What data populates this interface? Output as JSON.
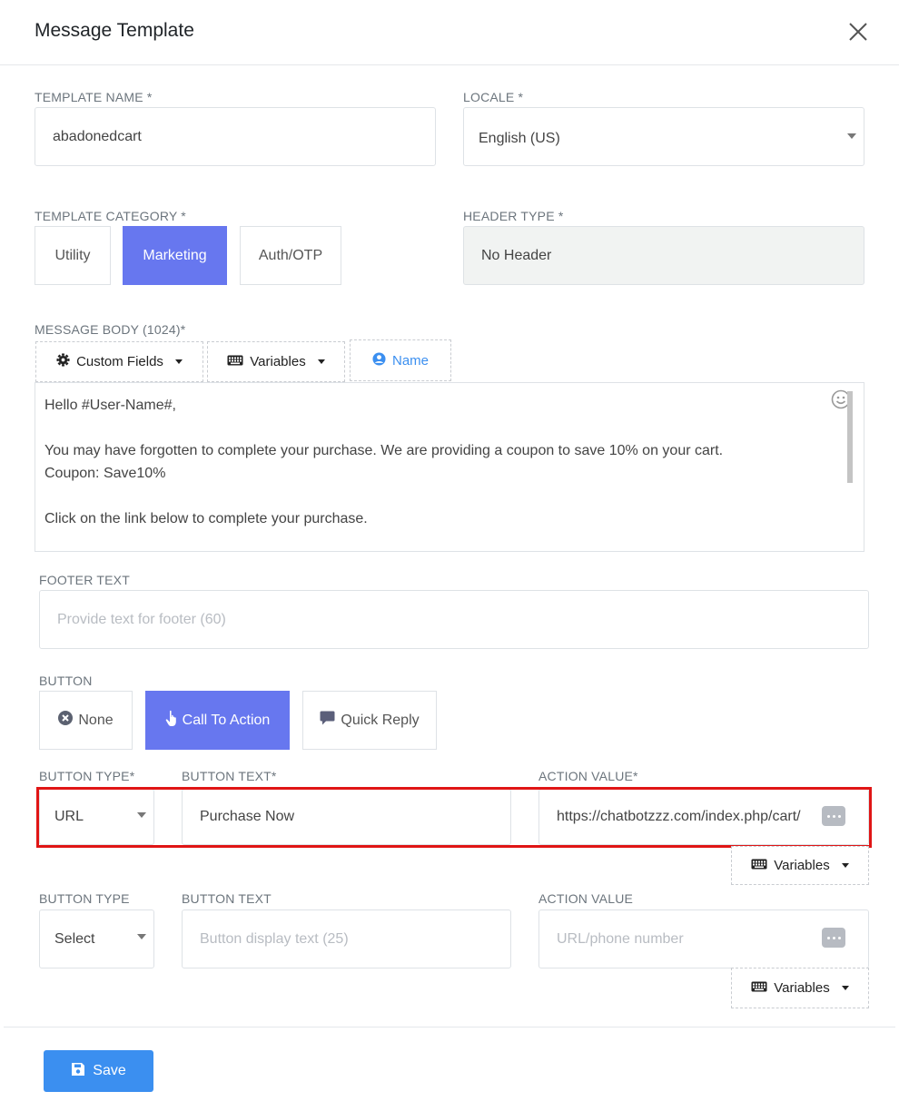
{
  "modal": {
    "title": "Message Template"
  },
  "template_name": {
    "label": "TEMPLATE NAME *",
    "value": "abadonedcart"
  },
  "locale": {
    "label": "LOCALE *",
    "value": "English (US)"
  },
  "category": {
    "label": "TEMPLATE CATEGORY *",
    "options": [
      "Utility",
      "Marketing",
      "Auth/OTP"
    ],
    "selected": "Marketing"
  },
  "header_type": {
    "label": "HEADER TYPE *",
    "value": "No Header"
  },
  "message_body": {
    "label": "MESSAGE BODY (1024)*",
    "toolbar": {
      "custom_fields": "Custom Fields",
      "variables": "Variables",
      "name": "Name"
    },
    "lines": [
      "Hello  #User-Name#,",
      "",
      "You may have forgotten to complete your purchase. We are providing a coupon to save 10% on your cart.",
      "Coupon: Save10%",
      "",
      "Click on the link below to complete your purchase."
    ]
  },
  "footer": {
    "label": "FOOTER TEXT",
    "placeholder": "Provide text for footer (60)"
  },
  "button_section": {
    "label": "BUTTON",
    "options": [
      "None",
      "Call To Action",
      "Quick Reply"
    ],
    "selected": "Call To Action"
  },
  "button_row_1": {
    "type_label": "BUTTON TYPE*",
    "text_label": "BUTTON TEXT*",
    "action_label": "ACTION VALUE*",
    "type_value": "URL",
    "text_value": "Purchase Now",
    "action_value": "https://chatbotzzz.com/index.php/cart/",
    "variables": "Variables"
  },
  "button_row_2": {
    "type_label": "BUTTON TYPE",
    "text_label": "BUTTON TEXT",
    "action_label": "ACTION VALUE",
    "type_value": "Select",
    "text_placeholder": "Button display text (25)",
    "action_placeholder": "URL/phone number",
    "variables": "Variables"
  },
  "save": {
    "label": "Save"
  },
  "colors": {
    "accent": "#6777ef",
    "primary": "#3b8ff0",
    "highlight": "#e01515",
    "link": "#3b8ff0"
  }
}
